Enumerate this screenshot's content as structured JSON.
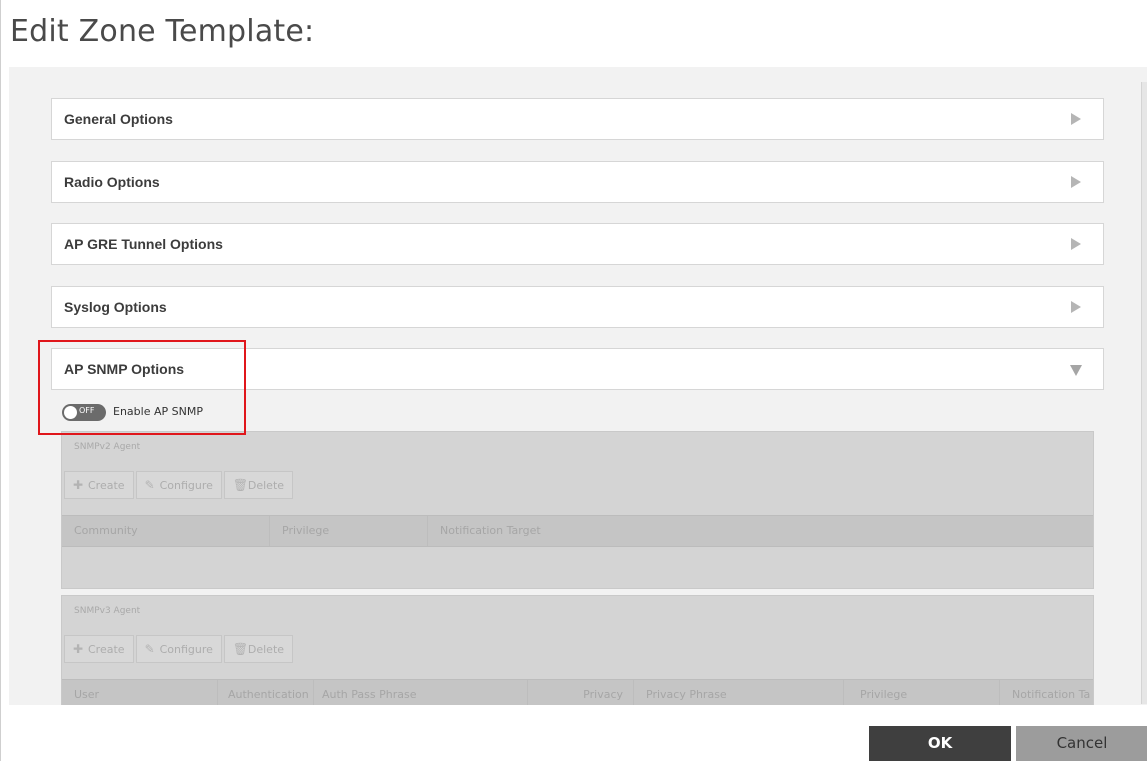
{
  "dialog": {
    "title": "Edit Zone Template:"
  },
  "sections": [
    {
      "label": "General Options",
      "expanded": false
    },
    {
      "label": "Radio Options",
      "expanded": false
    },
    {
      "label": "AP GRE Tunnel Options",
      "expanded": false
    },
    {
      "label": "Syslog Options",
      "expanded": false
    },
    {
      "label": "AP SNMP Options",
      "expanded": true
    }
  ],
  "snmp": {
    "toggle_state": "OFF",
    "toggle_label": "Enable AP SNMP",
    "v2": {
      "title": "SNMPv2 Agent",
      "buttons": {
        "create": "Create",
        "configure": "Configure",
        "delete": "Delete"
      },
      "columns": [
        "Community",
        "Privilege",
        "Notification Target"
      ]
    },
    "v3": {
      "title": "SNMPv3 Agent",
      "buttons": {
        "create": "Create",
        "configure": "Configure",
        "delete": "Delete"
      },
      "columns": [
        "User",
        "Authentication",
        "Auth Pass Phrase",
        "Privacy",
        "Privacy Phrase",
        "Privilege",
        "Notification Ta"
      ]
    }
  },
  "footer": {
    "ok_label": "OK",
    "cancel_label": "Cancel"
  },
  "colors": {
    "highlight": "#e0161b",
    "ok_bg": "#3f3f3f",
    "cancel_bg": "#9c9c9c"
  }
}
